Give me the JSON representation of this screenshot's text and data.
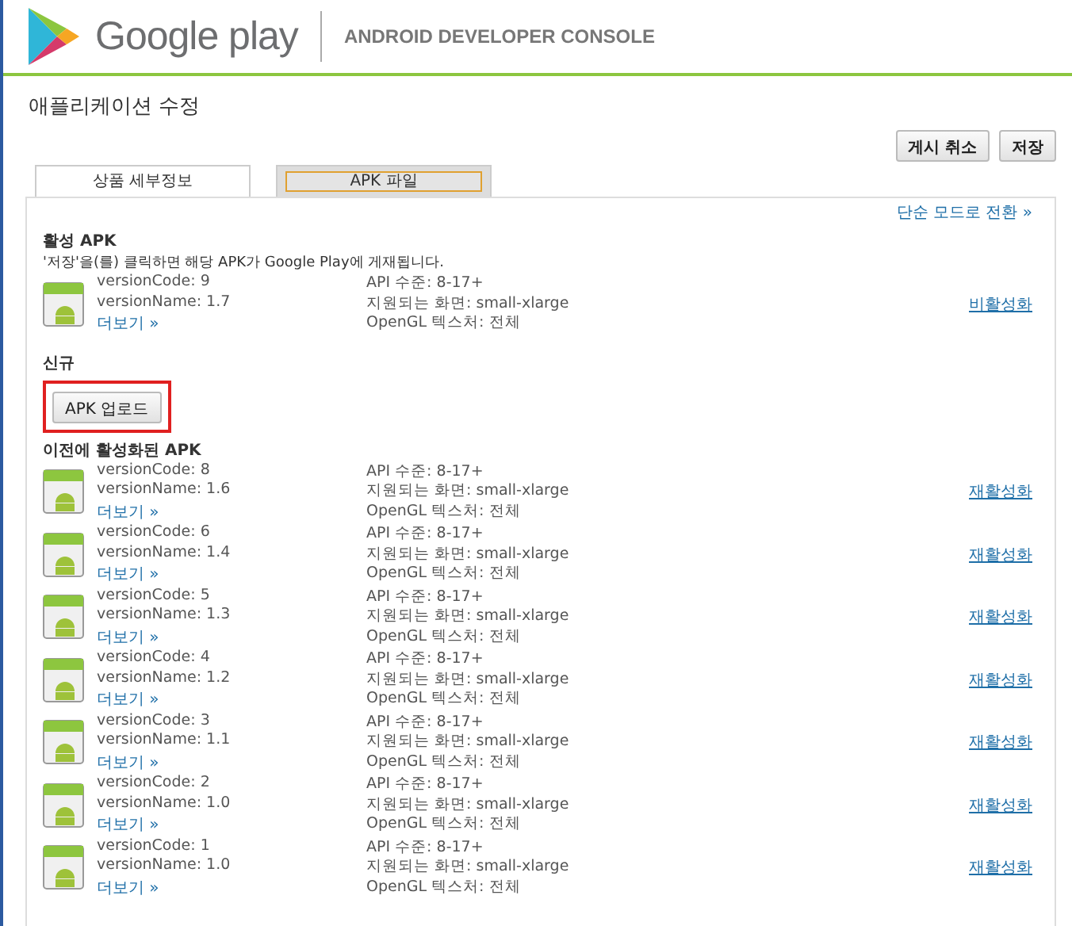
{
  "header": {
    "logo_text": "Google play",
    "console_title": "ANDROID DEVELOPER CONSOLE"
  },
  "page_title": "애플리케이션 수정",
  "actions": [
    "게시 취소",
    "저장"
  ],
  "tabs": [
    {
      "label": "상품 세부정보",
      "selected": false
    },
    {
      "label": "APK 파일",
      "selected": true
    }
  ],
  "simple_mode_link": "단순 모드로 전환 »",
  "active_section": {
    "title": "활성 APK",
    "note": "'저장'을(를) 클릭하면 해당 APK가 Google Play에 게재됩니다.",
    "apks": [
      {
        "version_code": "versionCode: 9",
        "version_name": "versionName: 1.7",
        "more": "더보기 »",
        "api": "API 수준: 8-17+",
        "screens": "지원되는 화면: small-xlarge",
        "opengl": "OpenGL 텍스처: 전체",
        "action": "비활성화"
      }
    ]
  },
  "new_section": {
    "title": "신규",
    "upload_button": "APK 업로드",
    "highlighted": true
  },
  "previous_section": {
    "title": "이전에 활성화된 APK",
    "apks": [
      {
        "version_code": "versionCode: 8",
        "version_name": "versionName: 1.6",
        "more": "더보기 »",
        "api": "API 수준: 8-17+",
        "screens": "지원되는 화면: small-xlarge",
        "opengl": "OpenGL 텍스처: 전체",
        "action": "재활성화"
      },
      {
        "version_code": "versionCode: 6",
        "version_name": "versionName: 1.4",
        "more": "더보기 »",
        "api": "API 수준: 8-17+",
        "screens": "지원되는 화면: small-xlarge",
        "opengl": "OpenGL 텍스처: 전체",
        "action": "재활성화"
      },
      {
        "version_code": "versionCode: 5",
        "version_name": "versionName: 1.3",
        "more": "더보기 »",
        "api": "API 수준: 8-17+",
        "screens": "지원되는 화면: small-xlarge",
        "opengl": "OpenGL 텍스처: 전체",
        "action": "재활성화"
      },
      {
        "version_code": "versionCode: 4",
        "version_name": "versionName: 1.2",
        "more": "더보기 »",
        "api": "API 수준: 8-17+",
        "screens": "지원되는 화면: small-xlarge",
        "opengl": "OpenGL 텍스처: 전체",
        "action": "재활성화"
      },
      {
        "version_code": "versionCode: 3",
        "version_name": "versionName: 1.1",
        "more": "더보기 »",
        "api": "API 수준: 8-17+",
        "screens": "지원되는 화면: small-xlarge",
        "opengl": "OpenGL 텍스처: 전체",
        "action": "재활성화"
      },
      {
        "version_code": "versionCode: 2",
        "version_name": "versionName: 1.0",
        "more": "더보기 »",
        "api": "API 수준: 8-17+",
        "screens": "지원되는 화면: small-xlarge",
        "opengl": "OpenGL 텍스처: 전체",
        "action": "재활성화"
      },
      {
        "version_code": "versionCode: 1",
        "version_name": "versionName: 1.0",
        "more": "더보기 »",
        "api": "API 수준: 8-17+",
        "screens": "지원되는 화면: small-xlarge",
        "opengl": "OpenGL 텍스처: 전체",
        "action": "재활성화"
      }
    ]
  }
}
